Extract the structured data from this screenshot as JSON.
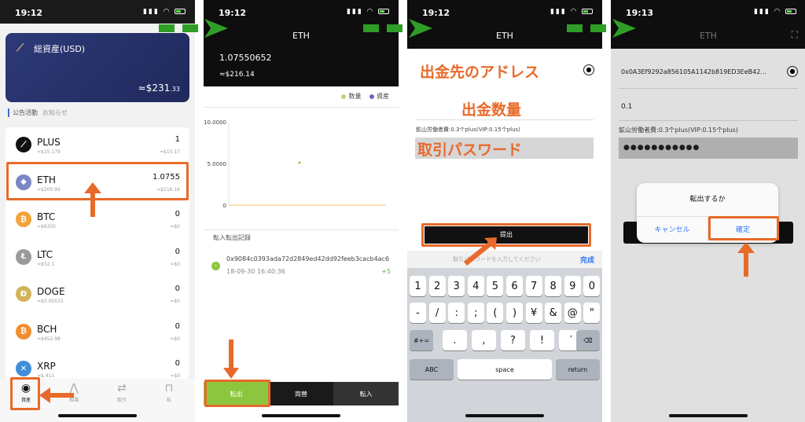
{
  "status_times": [
    "19:12",
    "19:12",
    "19:12",
    "19:13"
  ],
  "phone1": {
    "card_title": "総資産(USD)",
    "card_amount_prefix": "≈$231",
    "card_amount_decimals": ".33",
    "notice_tabs": [
      "公告活動",
      "お知らせ"
    ],
    "coins": [
      {
        "name": "PLUS",
        "sub": "≈$15.179",
        "qty": "1",
        "usd": "≈$15.17",
        "color": "#111111",
        "glyph": "⟋"
      },
      {
        "name": "ETH",
        "sub": "≈$200.99",
        "qty": "1.0755",
        "usd": "≈$216.16",
        "color": "#7b86c4",
        "glyph": "◆"
      },
      {
        "name": "BTC",
        "sub": "≈$6305",
        "qty": "0",
        "usd": "≈$0",
        "color": "#f2a33a",
        "glyph": "₿"
      },
      {
        "name": "LTC",
        "sub": "≈$52.1",
        "qty": "0",
        "usd": "≈$0",
        "color": "#9a9a9a",
        "glyph": "Ł"
      },
      {
        "name": "DOGE",
        "sub": "≈$0.00533",
        "qty": "0",
        "usd": "≈$0",
        "color": "#d1b45a",
        "glyph": "Ð"
      },
      {
        "name": "BCH",
        "sub": "≈$452.98",
        "qty": "0",
        "usd": "≈$0",
        "color": "#f08e30",
        "glyph": "₿"
      },
      {
        "name": "XRP",
        "sub": "≈$.411",
        "qty": "0",
        "usd": "≈$0",
        "color": "#3f8fd8",
        "glyph": "✕"
      }
    ],
    "tabs": [
      "資産",
      "相場",
      "取引",
      "私"
    ]
  },
  "phone2": {
    "title": "ETH",
    "balance": "1.07550652",
    "balance_usd": "≈$216.14",
    "legend": [
      {
        "label": "数量",
        "color": "#b9d96a"
      },
      {
        "label": "資産",
        "color": "#6b62c4"
      }
    ],
    "records_title": "転入転出記録",
    "record": {
      "hash": "0x9084c0393ada72d2849ed42dd92feeb3cacb4ac6",
      "date": "18-09-30 16:40:36",
      "amount": "+5"
    },
    "buttons": [
      "転出",
      "両替",
      "転入"
    ]
  },
  "chart_data": {
    "type": "scatter",
    "title": "",
    "xlabel": "",
    "ylabel": "",
    "yticks": [
      "10.0000",
      "5.0000",
      "0"
    ],
    "ylim": [
      0,
      10
    ],
    "series": [
      {
        "name": "数量",
        "values": [
          5.1
        ]
      }
    ],
    "legend_placement": "top-right",
    "grid": false
  },
  "phone3": {
    "title": "ETH",
    "label_address": "出金先のアドレス",
    "label_amount": "出金数量",
    "label_password": "取引パスワード",
    "fee": "鉱山労働者費:0.3个plus(VIP:0.15个plus)",
    "submit": "提出",
    "pw_placeholder": "取引パスワードを入力してください",
    "done": "完成",
    "row1": [
      "1",
      "2",
      "3",
      "4",
      "5",
      "6",
      "7",
      "8",
      "9",
      "0"
    ],
    "row2": [
      "-",
      "/",
      ":",
      ";",
      "(",
      ")",
      "¥",
      "&",
      "@",
      "\""
    ],
    "row3_left": "#+=",
    "row3": [
      ".",
      ",",
      "?",
      "!",
      "′"
    ],
    "row3_right": "⌫",
    "row4": [
      "ABC",
      "space",
      "return"
    ]
  },
  "phone4": {
    "title": "ETH",
    "address": "0x0A3Ef9292a856105A1142b819ED3EeB42...",
    "amount": "0.1",
    "fee": "鉱山労働者費:0.3个plus(VIP:0.15个plus)",
    "password_mask": "●●●●●●●●●●●",
    "dialog_title": "転出するか",
    "cancel": "キャンセル",
    "confirm": "確定"
  }
}
